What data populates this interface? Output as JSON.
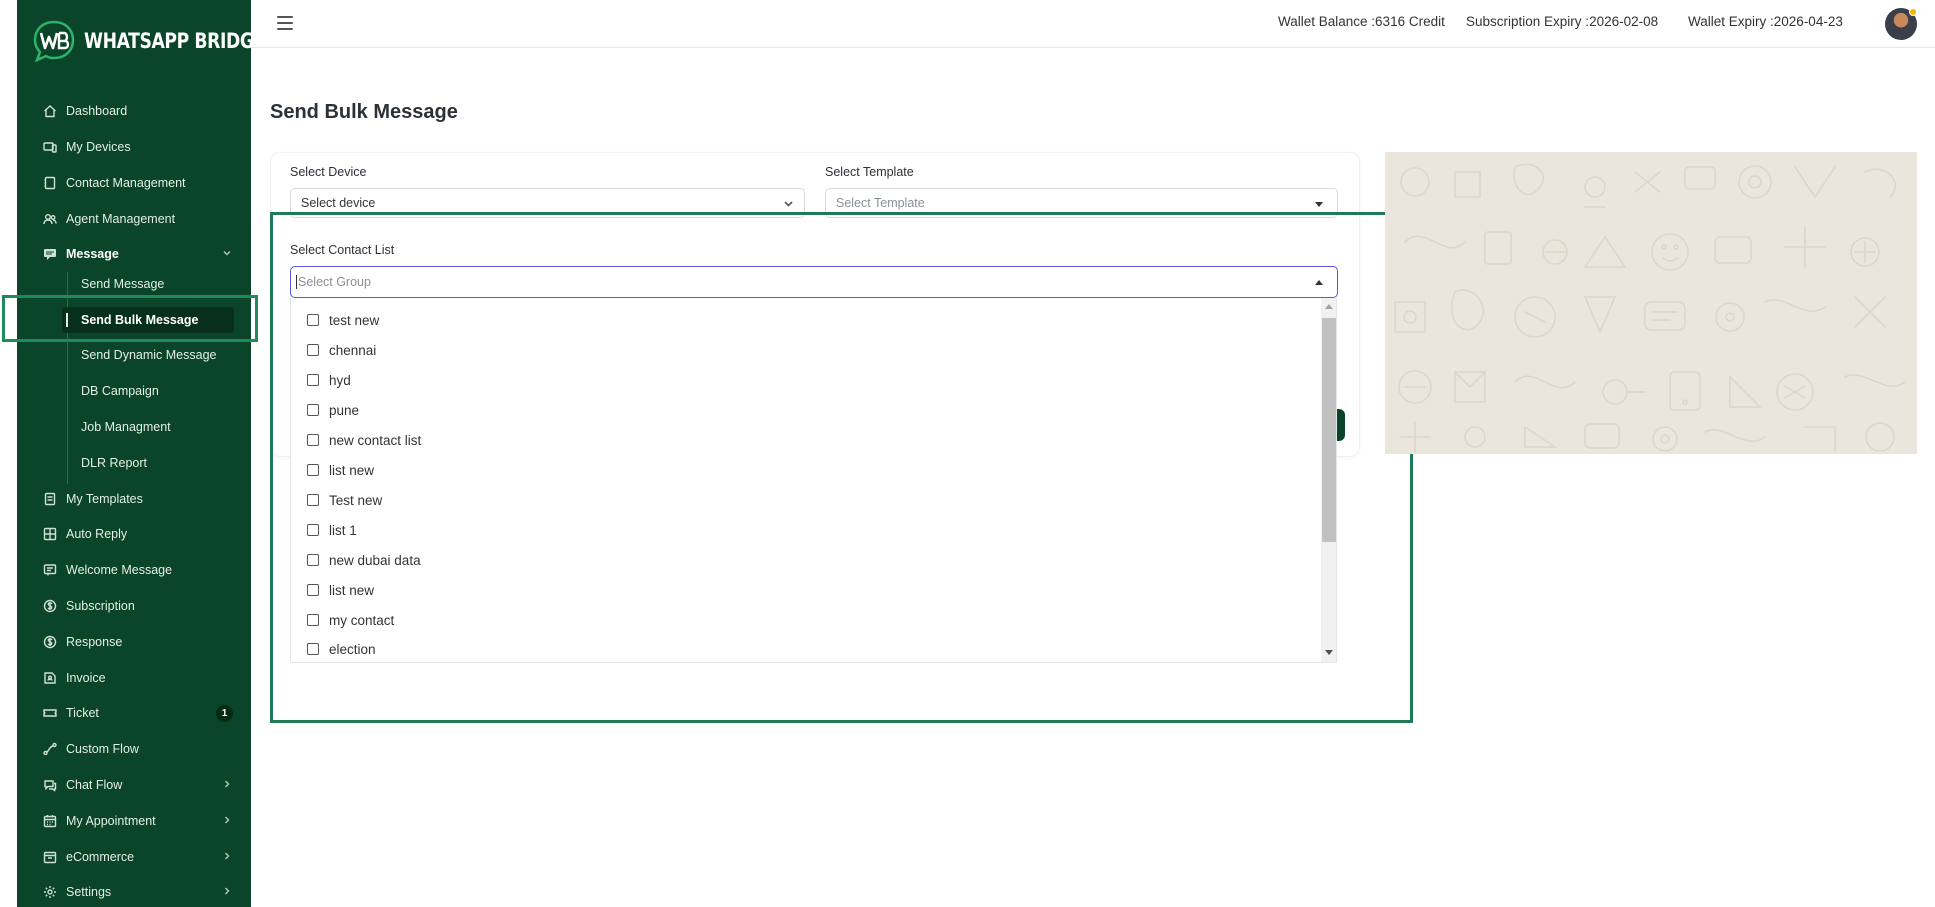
{
  "app": {
    "logo_text": "WHATSAPP BRIDGE"
  },
  "sidebar": {
    "items": [
      {
        "label": "Dashboard",
        "icon": "home-icon"
      },
      {
        "label": "My Devices",
        "icon": "devices-icon"
      },
      {
        "label": "Contact Management",
        "icon": "contact-book-icon"
      },
      {
        "label": "Agent Management",
        "icon": "agents-icon"
      },
      {
        "label": "Message",
        "icon": "message-icon",
        "expanded": true
      },
      {
        "label": "My Templates",
        "icon": "template-icon"
      },
      {
        "label": "Auto Reply",
        "icon": "auto-reply-icon"
      },
      {
        "label": "Welcome Message",
        "icon": "welcome-icon"
      },
      {
        "label": "Subscription",
        "icon": "dollar-icon"
      },
      {
        "label": "Response",
        "icon": "dollar-icon"
      },
      {
        "label": "Invoice",
        "icon": "invoice-icon"
      },
      {
        "label": "Ticket",
        "icon": "ticket-icon",
        "badge": "1"
      },
      {
        "label": "Custom Flow",
        "icon": "flow-icon"
      },
      {
        "label": "Chat Flow",
        "icon": "chat-icon"
      },
      {
        "label": "My Appointment",
        "icon": "calendar-icon"
      },
      {
        "label": "eCommerce",
        "icon": "store-icon"
      },
      {
        "label": "Settings",
        "icon": "gear-icon"
      }
    ],
    "message_sub": [
      "Send Message",
      "Send Bulk Message",
      "Send Dynamic Message",
      "DB Campaign",
      "Job Managment",
      "DLR Report"
    ],
    "active_sub": "Send Bulk Message"
  },
  "topbar": {
    "wallet_label": "Wallet Balance :",
    "wallet_value": "6316 Credit",
    "subscription_label": "Subscription Expiry :",
    "subscription_value": "2026-02-08",
    "wallet_expiry_label": "Wallet Expiry :",
    "wallet_expiry_value": "2026-04-23"
  },
  "main": {
    "title": "Send Bulk Message",
    "device_label": "Select Device",
    "device_value": "Select device",
    "template_label": "Select Template",
    "template_placeholder": "Select Template",
    "contact_label": "Select Contact List",
    "contact_placeholder": "Select Group",
    "contact_options": [
      "test new",
      "chennai",
      "hyd",
      "pune",
      "new contact list",
      "list new",
      "Test new",
      "list 1",
      "new dubai data",
      "list new",
      "my contact",
      "election"
    ]
  },
  "colors": {
    "sidebar_bg": "#0a4429",
    "highlight": "#1f8a5a",
    "focus": "#5b57d6"
  }
}
